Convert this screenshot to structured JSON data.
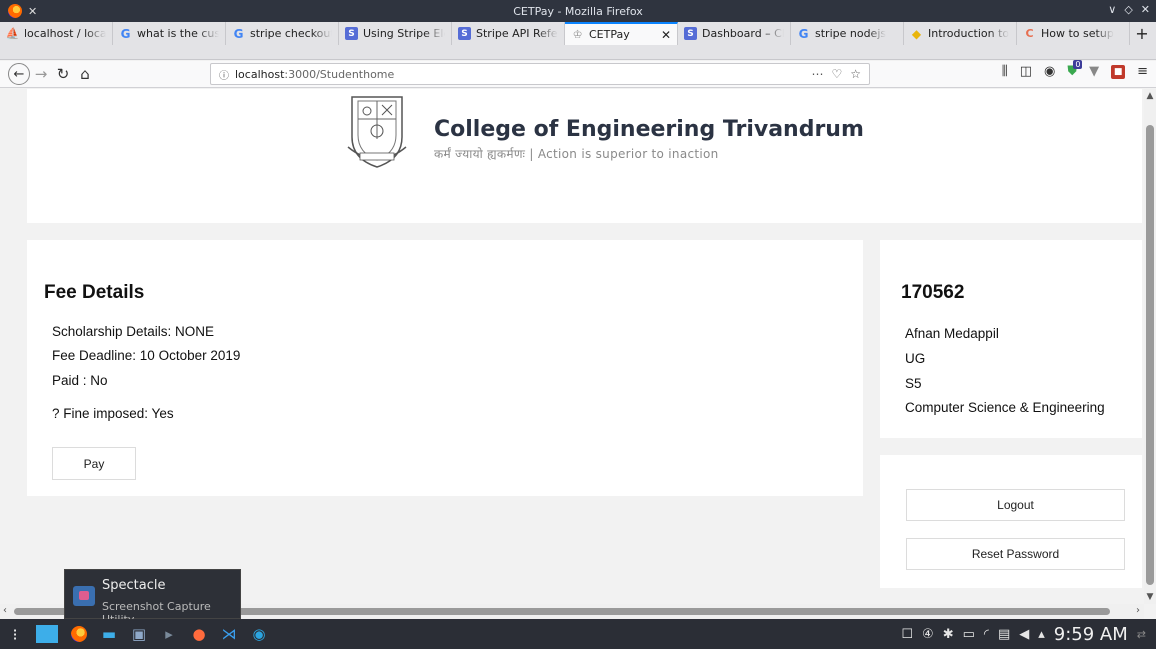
{
  "window": {
    "title": "CETPay - Mozilla Firefox",
    "controls": [
      "∨",
      "◇",
      "✕"
    ]
  },
  "tabs": [
    {
      "label": "localhost / localhost",
      "favicon": "phpmyadmin-icon"
    },
    {
      "label": "what is the customer",
      "favicon": "google-icon"
    },
    {
      "label": "stripe checkout",
      "favicon": "google-icon"
    },
    {
      "label": "Using Stripe Elements",
      "favicon": "stripe-icon"
    },
    {
      "label": "Stripe API Reference",
      "favicon": "stripe-icon"
    },
    {
      "label": "CETPay",
      "favicon": "cet-icon",
      "active": true
    },
    {
      "label": "Dashboard – Checkout",
      "favicon": "stripe-icon"
    },
    {
      "label": "stripe nodejs",
      "favicon": "google-icon"
    },
    {
      "label": "Introduction to",
      "favicon": "python-icon"
    },
    {
      "label": "How to setup",
      "favicon": "c-icon"
    }
  ],
  "tab_close": "✕",
  "new_tab": "+",
  "nav": {
    "url_host": "localhost",
    "url_path": ":3000/Studenthome",
    "ublock_count": "0"
  },
  "college": {
    "name": "College of Engineering Trivandrum",
    "motto": "कर्मं ज्यायो ह्यकर्मणः | Action is superior to inaction"
  },
  "fee": {
    "heading": "Fee Details",
    "scholarship": "Scholarship Details: NONE",
    "deadline": "Fee Deadline: 10 October 2019",
    "paid": "Paid : No",
    "fine": "?   Fine imposed: Yes",
    "pay_label": "Pay"
  },
  "student": {
    "id": "170562",
    "name": "Afnan Medappil",
    "program": "UG",
    "semester": "S5",
    "department": "Computer Science & Engineering"
  },
  "actions": {
    "logout_label": "Logout",
    "reset_label": "Reset Password"
  },
  "tooltip": {
    "title": "Spectacle",
    "subtitle": "Screenshot Capture Utility"
  },
  "taskbar": {
    "clock": "9:59 AM"
  },
  "colors": {
    "accent_tab": "#0a84ff",
    "page_bg": "#f2f2f2",
    "heading_text": "#2b3343"
  }
}
